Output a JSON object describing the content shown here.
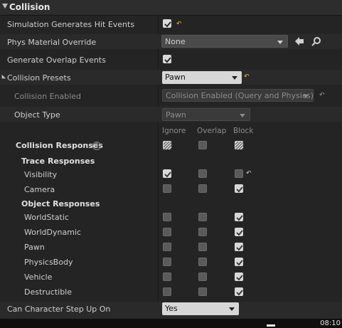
{
  "section": {
    "title": "Collision"
  },
  "rows": {
    "sim_hit_events": {
      "label": "Simulation Generates Hit Events",
      "checked": true
    },
    "phys_material": {
      "label": "Phys Material Override",
      "value": "None"
    },
    "overlap_events": {
      "label": "Generate Overlap Events",
      "checked": true
    },
    "presets": {
      "label": "Collision Presets",
      "value": "Pawn"
    },
    "collision_enabled": {
      "label": "Collision Enabled",
      "value": "Collision Enabled (Query and Physics)"
    },
    "object_type": {
      "label": "Object Type",
      "value": "Pawn"
    },
    "step_up": {
      "label": "Can Character Step Up On",
      "value": "Yes"
    }
  },
  "responses": {
    "label": "Collision Responses",
    "columns": [
      "Ignore",
      "Overlap",
      "Block"
    ],
    "trace_label": "Trace Responses",
    "object_label": "Object Responses",
    "trace": [
      {
        "name": "Visibility",
        "state": "ignore"
      },
      {
        "name": "Camera",
        "state": "block"
      }
    ],
    "object": [
      {
        "name": "WorldStatic",
        "state": "block"
      },
      {
        "name": "WorldDynamic",
        "state": "block"
      },
      {
        "name": "Pawn",
        "state": "block"
      },
      {
        "name": "PhysicsBody",
        "state": "block"
      },
      {
        "name": "Vehicle",
        "state": "block"
      },
      {
        "name": "Destructible",
        "state": "block"
      }
    ]
  },
  "taskbar": {
    "clock": "08:10"
  },
  "colors": {
    "panel": "#242424",
    "reset_accent": "#e6c020"
  }
}
